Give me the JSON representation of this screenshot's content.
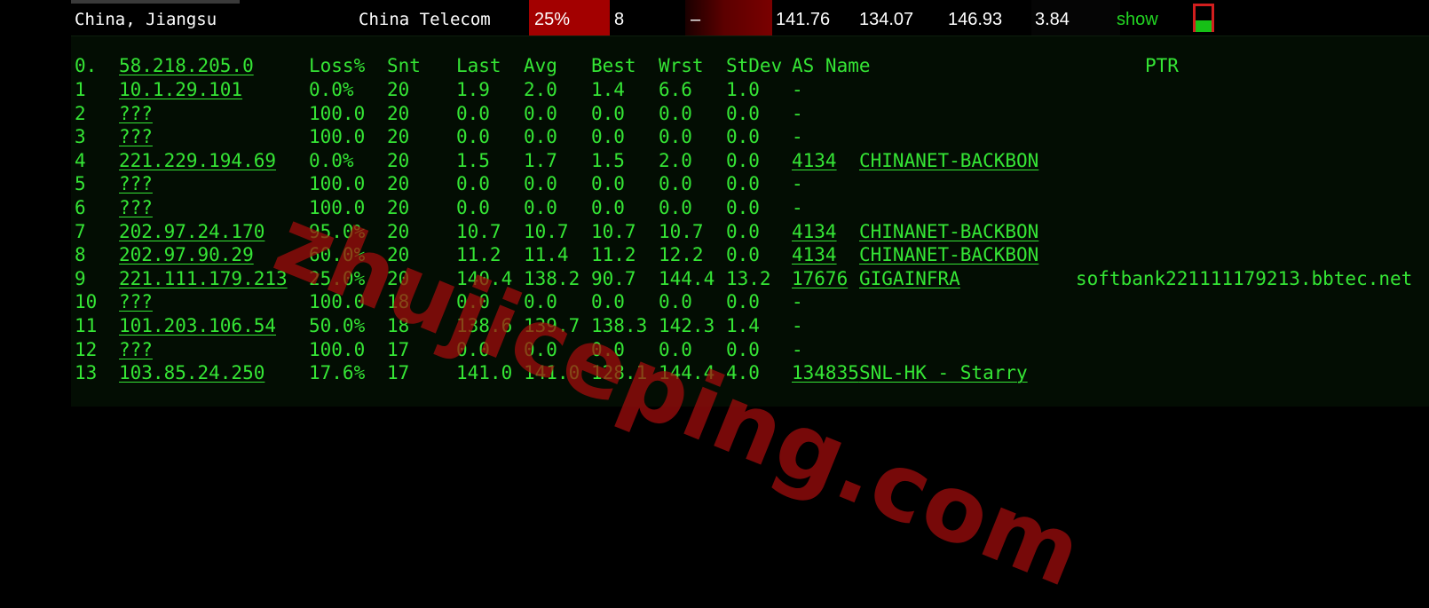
{
  "summary": {
    "location": "China, Jiangsu",
    "isp": "China Telecom",
    "loss": "25%",
    "count": "8",
    "bar_text": "–",
    "v1": "141.76",
    "v2": "134.07",
    "v3": "146.93",
    "v4": "3.84",
    "show_label": "show",
    "mini_chart_fill": 0.45,
    "colors": {
      "loss_bg": "#a30000",
      "show": "#22d422",
      "chart_border": "#d21e1e",
      "chart_fill": "#16c016"
    }
  },
  "columns": {
    "hop": "0.",
    "host": "58.218.205.0",
    "loss": "Loss%",
    "snt": "Snt",
    "last": "Last",
    "avg": "Avg",
    "best": "Best",
    "wrst": "Wrst",
    "stdev": "StDev",
    "as": "AS Name",
    "ptr": "PTR"
  },
  "hops": [
    {
      "hop": "1",
      "host": "10.1.29.101",
      "loss": "0.0%",
      "snt": "20",
      "last": "1.9",
      "avg": "2.0",
      "best": "1.4",
      "wrst": "6.6",
      "stdev": "1.0",
      "as": "-",
      "asname": "",
      "ptr": ""
    },
    {
      "hop": "2",
      "host": "???",
      "loss": "100.0",
      "snt": "20",
      "last": "0.0",
      "avg": "0.0",
      "best": "0.0",
      "wrst": "0.0",
      "stdev": "0.0",
      "as": "-",
      "asname": "",
      "ptr": ""
    },
    {
      "hop": "3",
      "host": "???",
      "loss": "100.0",
      "snt": "20",
      "last": "0.0",
      "avg": "0.0",
      "best": "0.0",
      "wrst": "0.0",
      "stdev": "0.0",
      "as": "-",
      "asname": "",
      "ptr": ""
    },
    {
      "hop": "4",
      "host": "221.229.194.69",
      "loss": "0.0%",
      "snt": "20",
      "last": "1.5",
      "avg": "1.7",
      "best": "1.5",
      "wrst": "2.0",
      "stdev": "0.0",
      "as": "4134",
      "asname": "CHINANET-BACKBON",
      "ptr": ""
    },
    {
      "hop": "5",
      "host": "???",
      "loss": "100.0",
      "snt": "20",
      "last": "0.0",
      "avg": "0.0",
      "best": "0.0",
      "wrst": "0.0",
      "stdev": "0.0",
      "as": "-",
      "asname": "",
      "ptr": ""
    },
    {
      "hop": "6",
      "host": "???",
      "loss": "100.0",
      "snt": "20",
      "last": "0.0",
      "avg": "0.0",
      "best": "0.0",
      "wrst": "0.0",
      "stdev": "0.0",
      "as": "-",
      "asname": "",
      "ptr": ""
    },
    {
      "hop": "7",
      "host": "202.97.24.170",
      "loss": "95.0%",
      "snt": "20",
      "last": "10.7",
      "avg": "10.7",
      "best": "10.7",
      "wrst": "10.7",
      "stdev": "0.0",
      "as": "4134",
      "asname": "CHINANET-BACKBON",
      "ptr": ""
    },
    {
      "hop": "8",
      "host": "202.97.90.29",
      "loss": "60.0%",
      "snt": "20",
      "last": "11.2",
      "avg": "11.4",
      "best": "11.2",
      "wrst": "12.2",
      "stdev": "0.0",
      "as": "4134",
      "asname": "CHINANET-BACKBON",
      "ptr": ""
    },
    {
      "hop": "9",
      "host": "221.111.179.213",
      "loss": "25.0%",
      "snt": "20",
      "last": "140.4",
      "avg": "138.2",
      "best": "90.7",
      "wrst": "144.4",
      "stdev": "13.2",
      "as": "17676",
      "asname": "GIGAINFRA",
      "ptr": "softbank221111179213.bbtec.net"
    },
    {
      "hop": "10",
      "host": "???",
      "loss": "100.0",
      "snt": "18",
      "last": "0.0",
      "avg": "0.0",
      "best": "0.0",
      "wrst": "0.0",
      "stdev": "0.0",
      "as": "-",
      "asname": "",
      "ptr": ""
    },
    {
      "hop": "11",
      "host": "101.203.106.54",
      "loss": "50.0%",
      "snt": "18",
      "last": "138.6",
      "avg": "139.7",
      "best": "138.3",
      "wrst": "142.3",
      "stdev": "1.4",
      "as": "-",
      "asname": "",
      "ptr": ""
    },
    {
      "hop": "12",
      "host": "???",
      "loss": "100.0",
      "snt": "17",
      "last": "0.0",
      "avg": "0.0",
      "best": "0.0",
      "wrst": "0.0",
      "stdev": "0.0",
      "as": "-",
      "asname": "",
      "ptr": ""
    },
    {
      "hop": "13",
      "host": "103.85.24.250",
      "loss": "17.6%",
      "snt": "17",
      "last": "141.0",
      "avg": "141.0",
      "best": "128.1",
      "wrst": "144.4",
      "stdev": "4.0",
      "as": "134835",
      "asname": "SNL-HK - Starry",
      "ptr": ""
    }
  ],
  "watermark": "zhujiceping.com"
}
